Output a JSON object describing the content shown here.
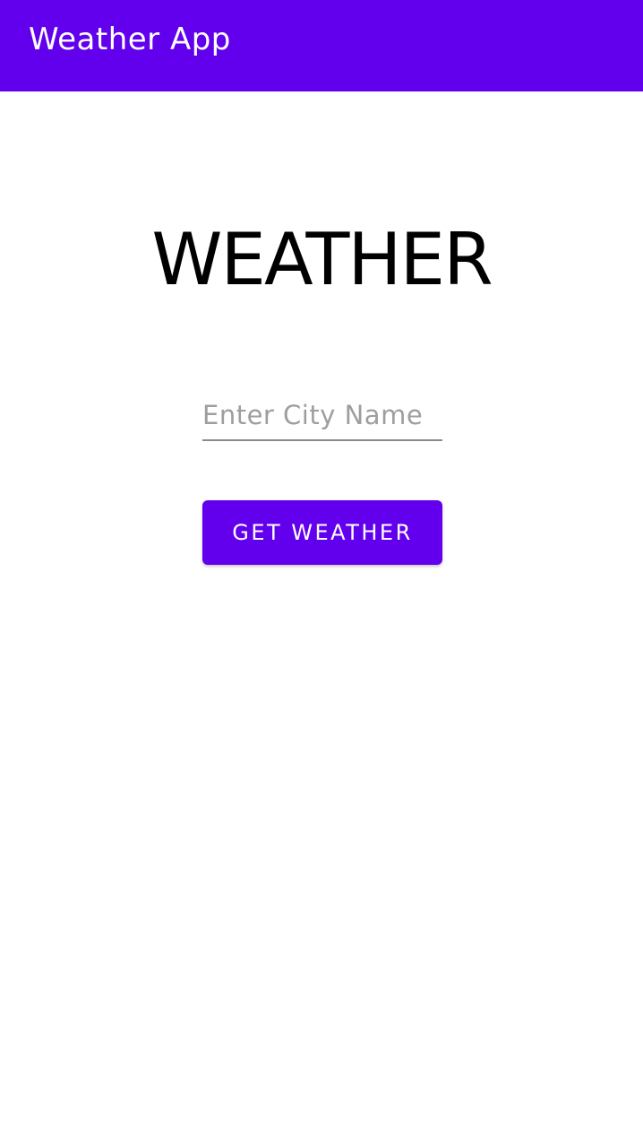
{
  "app_bar": {
    "title": "Weather App",
    "color": "#6200ee"
  },
  "main": {
    "heading": "WEATHER",
    "city_input": {
      "value": "",
      "placeholder": "Enter City Name"
    },
    "get_weather_button": {
      "label": "GET WEATHER",
      "color": "#6200ee"
    }
  }
}
